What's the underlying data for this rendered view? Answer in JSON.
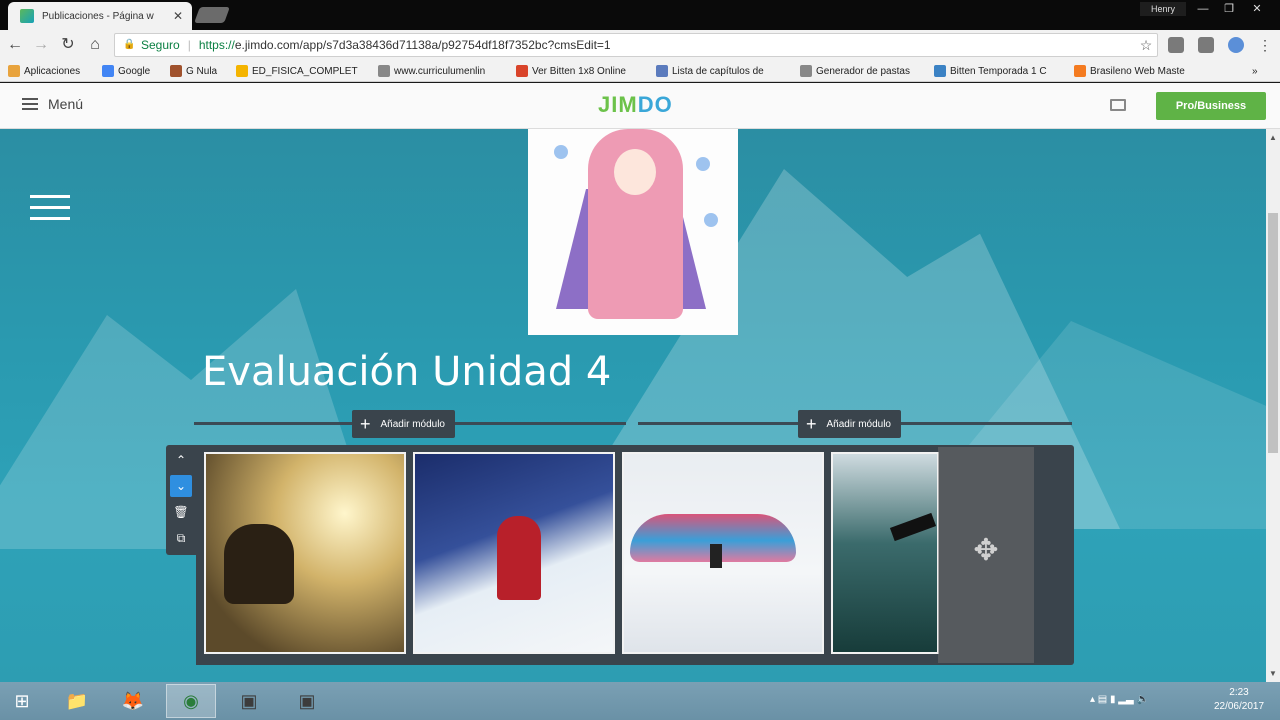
{
  "browser": {
    "tab_title": "Publicaciones - Página w",
    "tab_close": "✕",
    "user": "Henry",
    "window_buttons": [
      "—",
      "❐",
      "✕"
    ],
    "secure_label": "Seguro",
    "url_scheme": "https://",
    "url_rest": "e.jimdo.com/app/s7d3a38436d71138a/p92754df18f7352bc?cmsEdit=1",
    "bookmarks": [
      {
        "label": "Aplicaciones",
        "color": "#e8a33d"
      },
      {
        "label": "Google",
        "color": "#4285f4"
      },
      {
        "label": "G Nula",
        "color": "#a0522d"
      },
      {
        "label": "ED_FISICA_COMPLET",
        "color": "#f4b400"
      },
      {
        "label": "www.curriculumenlin",
        "color": "#888888"
      },
      {
        "label": "Ver Bitten 1x8 Online",
        "color": "#d9442a"
      },
      {
        "label": "Lista de capítulos de",
        "color": "#5b7bbd"
      },
      {
        "label": "Generador de pastas",
        "color": "#888888"
      },
      {
        "label": "Bitten Temporada 1 C",
        "color": "#3b82c4"
      },
      {
        "label": "Brasileno Web Maste",
        "color": "#f47b20"
      }
    ],
    "bookmarks_more": "»"
  },
  "jimdo": {
    "menu_label": "Menú",
    "logo_parts": [
      "JIM",
      "DO"
    ],
    "pro_button": "Pro/Business"
  },
  "page": {
    "title": "Evaluación Unidad 4",
    "add_module_left": "Añadir módulo",
    "add_module_right": "Añadir módulo",
    "add_icon": "+",
    "controls": [
      "⌃",
      "⌄",
      "🗑",
      "⧉"
    ],
    "move_icon": "✥",
    "gallery": [
      {
        "name": "kitesurfing-photo"
      },
      {
        "name": "snow-hiker-photo"
      },
      {
        "name": "paraglider-photo"
      },
      {
        "name": "surfer-photo"
      }
    ]
  },
  "taskbar": {
    "start": "⊞",
    "apps": [
      "📁",
      "🦊",
      "◉",
      "▣",
      "▣"
    ],
    "tray": "▴  ▤  ▮  ▂▃  🔈",
    "time": "2:23",
    "date": "22/06/2017"
  }
}
